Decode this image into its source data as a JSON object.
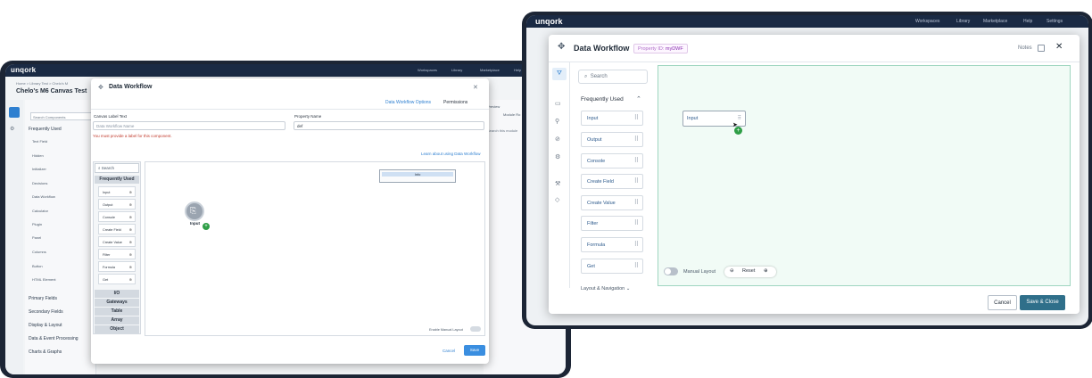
{
  "app": {
    "logo": "unqork"
  },
  "left": {
    "topnav": [
      "Workspaces",
      "Library",
      "Marketplace",
      "Help"
    ],
    "breadcrumb": "Home > Library Test > Chelo's M",
    "page_title": "Chelo's M6 Canvas Test",
    "panel_search": "Search Components",
    "panel_frequently_used": "Frequently Used",
    "panel_items": [
      "Text Field",
      "Hidden",
      "Initializer",
      "Decisions",
      "Data Workflow",
      "Calculator",
      "Plugin",
      "Panel",
      "Columns",
      "Button",
      "HTML Element"
    ],
    "panel_sections": [
      "Primary Fields",
      "Secondary Fields",
      "Display & Layout",
      "Data & Event Processing",
      "Charts & Graphs"
    ],
    "right_panel": {
      "preview": "Preview",
      "module_label": "Module Ro",
      "search": "Search this module"
    },
    "modal": {
      "title": "Data Workflow",
      "tabs": [
        "Data Workflow Options",
        "Permissions"
      ],
      "canvas_label_text": "Canvas Label Text",
      "canvas_label_placeholder": "Data Workflow Name",
      "property_name_label": "Property Name",
      "property_name_value": "def",
      "error": "You must provide a label for this component.",
      "learn_link": "Learn about using Data Workflow",
      "search_placeholder": "Search",
      "frequently_used": "Frequently Used",
      "operators": [
        "Input",
        "Output",
        "Console",
        "Create Field",
        "Create Value",
        "Filter",
        "Formula",
        "Get"
      ],
      "categories": [
        "I/O",
        "Gateways",
        "Table",
        "Array",
        "Object"
      ],
      "info_box": "Info",
      "node_label": "Input",
      "manual_layout": "Enable Manual Layout",
      "cancel": "Cancel",
      "save": "Save"
    }
  },
  "right": {
    "topnav": [
      "Workspaces",
      "Library",
      "Marketplace",
      "Help",
      "Settings"
    ],
    "modal": {
      "title": "Data Workflow",
      "property_id_label": "Property ID:",
      "property_id_value": "myDWF",
      "notes": "Notes",
      "search_placeholder": "Search",
      "frequently_used": "Frequently Used",
      "operators": [
        "Input",
        "Output",
        "Console",
        "Create Field",
        "Create Value",
        "Filter",
        "Formula",
        "Get"
      ],
      "layout_section": "Layout & Navigation",
      "node_label": "Input",
      "manual_layout": "Manual Layout",
      "reset": "Reset",
      "cancel": "Cancel",
      "save_close": "Save & Close"
    }
  }
}
